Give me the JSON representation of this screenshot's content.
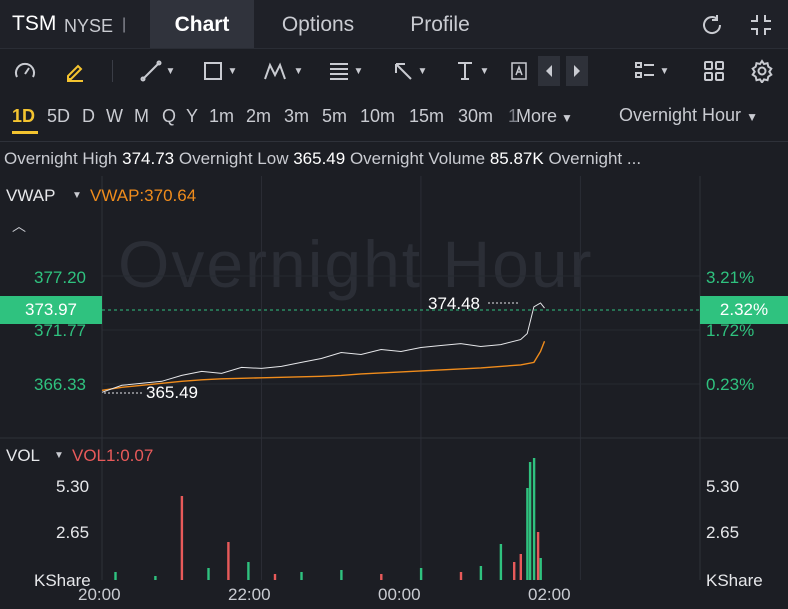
{
  "header": {
    "ticker": "TSM",
    "exchange": "NYSE",
    "separator": "|",
    "tabs": [
      {
        "label": "Chart",
        "active": true
      },
      {
        "label": "Options",
        "active": false
      },
      {
        "label": "Profile",
        "active": false
      }
    ],
    "icons": [
      "refresh-icon",
      "fullscreen-collapse-icon"
    ]
  },
  "toolbar": {
    "icons": [
      "indicator-gauge-icon",
      "draw-pencil-icon",
      "trend-line-icon",
      "rectangle-icon",
      "pattern-icon",
      "fib-text-icon",
      "arrow-icon",
      "price-range-icon",
      "text-tool-icon",
      "scroll-left-icon",
      "scroll-right-icon",
      "layout-list-icon",
      "grid-icon",
      "settings-icon"
    ]
  },
  "intervals": {
    "items": [
      "1D",
      "5D",
      "D",
      "W",
      "M",
      "Q",
      "Y",
      "1m",
      "2m",
      "3m",
      "5m",
      "10m",
      "15m",
      "30m",
      "1"
    ],
    "active": "1D",
    "more_label": "More",
    "session_label": "Overnight Hour"
  },
  "stats": {
    "high_label": "Overnight High",
    "high_value": "374.73",
    "low_label": "Overnight Low",
    "low_value": "365.49",
    "volume_label": "Overnight Volume",
    "volume_value": "85.87K",
    "trailing_label": "Overnight ..."
  },
  "watermark": "Overnight Hour",
  "price_panel": {
    "indicator_name": "VWAP",
    "indicator_value": "VWAP:370.64",
    "current_price": "373.97",
    "current_pct": "2.32%",
    "left_ticks": [
      "377.20",
      "371.77",
      "366.33"
    ],
    "right_ticks": [
      "3.21%",
      "1.72%",
      "0.23%"
    ],
    "high_annotation": "374.48",
    "low_annotation": "365.49",
    "colors": {
      "up": "#2fc27f",
      "down": "#e85a5a",
      "vwap": "#f08c1c",
      "price": "#ffffff"
    }
  },
  "volume_panel": {
    "indicator_name": "VOL",
    "indicator_value": "VOL1:0.07",
    "left_ticks": [
      "5.30",
      "2.65",
      "KShare"
    ],
    "right_ticks": [
      "5.30",
      "2.65",
      "KShare"
    ]
  },
  "x_axis": {
    "labels": [
      "20:00",
      "22:00",
      "00:00",
      "02:00"
    ]
  },
  "chart_data": {
    "type": "line",
    "x_range": [
      "20:00",
      "03:30"
    ],
    "y_range": [
      365.2,
      378.5
    ],
    "series": [
      {
        "name": "VWAP",
        "x": [
          "20:00",
          "20:15",
          "20:30",
          "20:45",
          "21:00",
          "21:15",
          "21:30",
          "21:45",
          "22:00",
          "22:15",
          "22:30",
          "22:45",
          "23:00",
          "23:15",
          "23:30",
          "23:45",
          "00:00",
          "00:15",
          "00:30",
          "00:45",
          "01:00",
          "01:15",
          "01:25",
          "01:30",
          "01:33"
        ],
        "values": [
          365.7,
          366.0,
          366.2,
          366.4,
          366.6,
          366.75,
          366.85,
          366.9,
          366.95,
          367.0,
          367.05,
          367.1,
          367.2,
          367.35,
          367.45,
          367.55,
          367.65,
          367.75,
          367.85,
          367.95,
          368.1,
          368.25,
          368.5,
          369.6,
          370.64
        ]
      },
      {
        "name": "Price",
        "x": [
          "20:00",
          "20:15",
          "20:30",
          "20:45",
          "21:00",
          "21:15",
          "21:30",
          "21:45",
          "22:00",
          "22:15",
          "22:30",
          "22:45",
          "23:00",
          "23:15",
          "23:30",
          "23:45",
          "00:00",
          "00:15",
          "00:30",
          "00:45",
          "01:00",
          "01:15",
          "01:20",
          "01:25",
          "01:30",
          "01:33"
        ],
        "values": [
          365.49,
          366.2,
          366.4,
          366.6,
          367.2,
          367.6,
          367.4,
          368.0,
          367.9,
          368.1,
          368.5,
          368.9,
          369.5,
          369.3,
          369.8,
          369.6,
          370.0,
          370.2,
          370.4,
          370.1,
          370.3,
          370.8,
          371.4,
          374.1,
          374.48,
          373.97
        ]
      }
    ],
    "volume": {
      "unit": "KShare",
      "y_range": [
        0,
        6.0
      ],
      "x": [
        "20:10",
        "20:40",
        "21:00",
        "21:20",
        "21:35",
        "21:50",
        "22:10",
        "22:30",
        "23:00",
        "23:30",
        "00:00",
        "00:30",
        "00:45",
        "01:00",
        "01:10",
        "01:15",
        "01:20",
        "01:22",
        "01:25",
        "01:28",
        "01:30"
      ],
      "values": [
        0.4,
        0.2,
        4.2,
        0.6,
        1.9,
        0.9,
        0.3,
        0.4,
        0.5,
        0.3,
        0.6,
        0.4,
        0.7,
        1.8,
        0.9,
        1.3,
        4.6,
        5.9,
        6.1,
        2.4,
        1.1
      ],
      "direction": [
        "up",
        "up",
        "down",
        "up",
        "down",
        "up",
        "down",
        "up",
        "up",
        "down",
        "up",
        "down",
        "up",
        "up",
        "down",
        "down",
        "up",
        "up",
        "up",
        "down",
        "up"
      ]
    }
  }
}
